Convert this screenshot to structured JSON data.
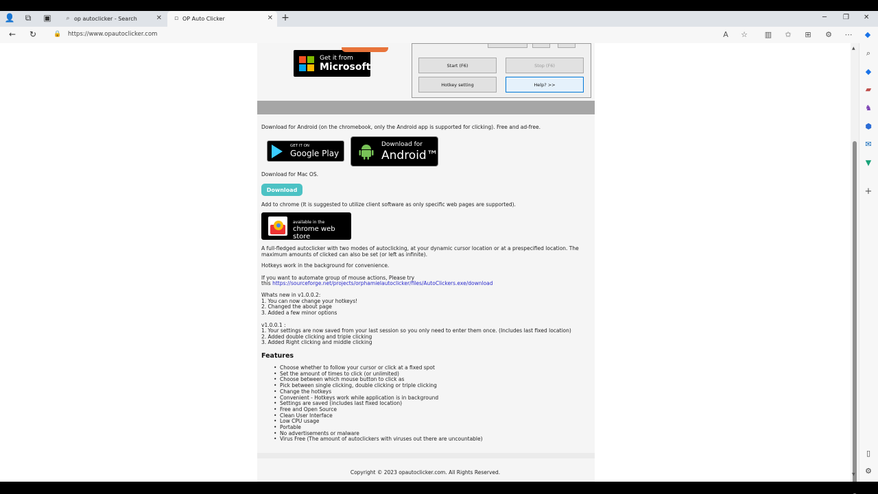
{
  "browser": {
    "tabs": [
      {
        "label": "op autoclicker - Search",
        "icon": "search-icon"
      },
      {
        "label": "OP Auto Clicker",
        "icon": "page-icon"
      }
    ],
    "url": "https://www.opautoclicker.com"
  },
  "page": {
    "ms_badge": {
      "top": "Get it from",
      "big": "Microsoft"
    },
    "app_buttons": {
      "start": "Start (F6)",
      "stop": "Stop (F6)",
      "hotkey": "Hotkey setting",
      "help": "Help? >>"
    },
    "android_text": "Download for Android (on the chromebook, only the Android app is supported for clicking). Free and ad-free.",
    "google_play": {
      "small": "GET IT ON",
      "big": "Google Play"
    },
    "android_badge": {
      "small": "Download for",
      "big": "Android™"
    },
    "mac_text": "Download for Mac OS.",
    "download_label": "Download",
    "chrome_text": "Add to chrome (It is suggested to utilize client software as only specific web pages are supported).",
    "cws": {
      "small": "available in the",
      "big": "chrome web store"
    },
    "desc1": "A full-fledged autoclicker with two modes of autoclicking, at your dynamic cursor location or at a prespecified location. The maximum amounts of clicked can also be set (or left as infinite).",
    "desc2": "Hotkeys work in the background for convenience.",
    "automate_text": "If you want to automate group of mouse actions, Please try",
    "automate_prefix": "this",
    "automate_link": "https://sourceforge.net/projects/orphamielautoclicker/files/AutoClickers.exe/download",
    "whatsnew_title": "Whats new in v1.0.0.2:",
    "whatsnew": [
      "1. You can now change your hotkeys!",
      "2. Changed the about page",
      "3. Added a few minor options"
    ],
    "v1_title": "v1.0.0.1 :",
    "v1": [
      "1. Your settings are now saved from your last session so you only need to enter them once. (Includes last fixed location)",
      "2. Added double clicking and triple clicking",
      "3. Added Right clicking and middle clicking"
    ],
    "features_title": "Features",
    "features": [
      "Choose whether to follow your cursor or click at a fixed spot",
      "Set the amount of times to click (or unlimited)",
      "Choose between which mouse button to click as",
      "Pick between single clicking, double clicking or triple clicking",
      "Change the hotkeys",
      "Convenient - Hotkeys work while application is in background",
      "Settings are saved (includes last fixed location)",
      "Free and Open Source",
      "Clean User Interface",
      "Low CPU usage",
      "Portable",
      "No advertisements or malware",
      "Virus Free (The amount of autoclickers with viruses out there are uncountable)"
    ],
    "copyright": "Copyright © 2023 opautoclicker.com. All Rights Reserved."
  }
}
